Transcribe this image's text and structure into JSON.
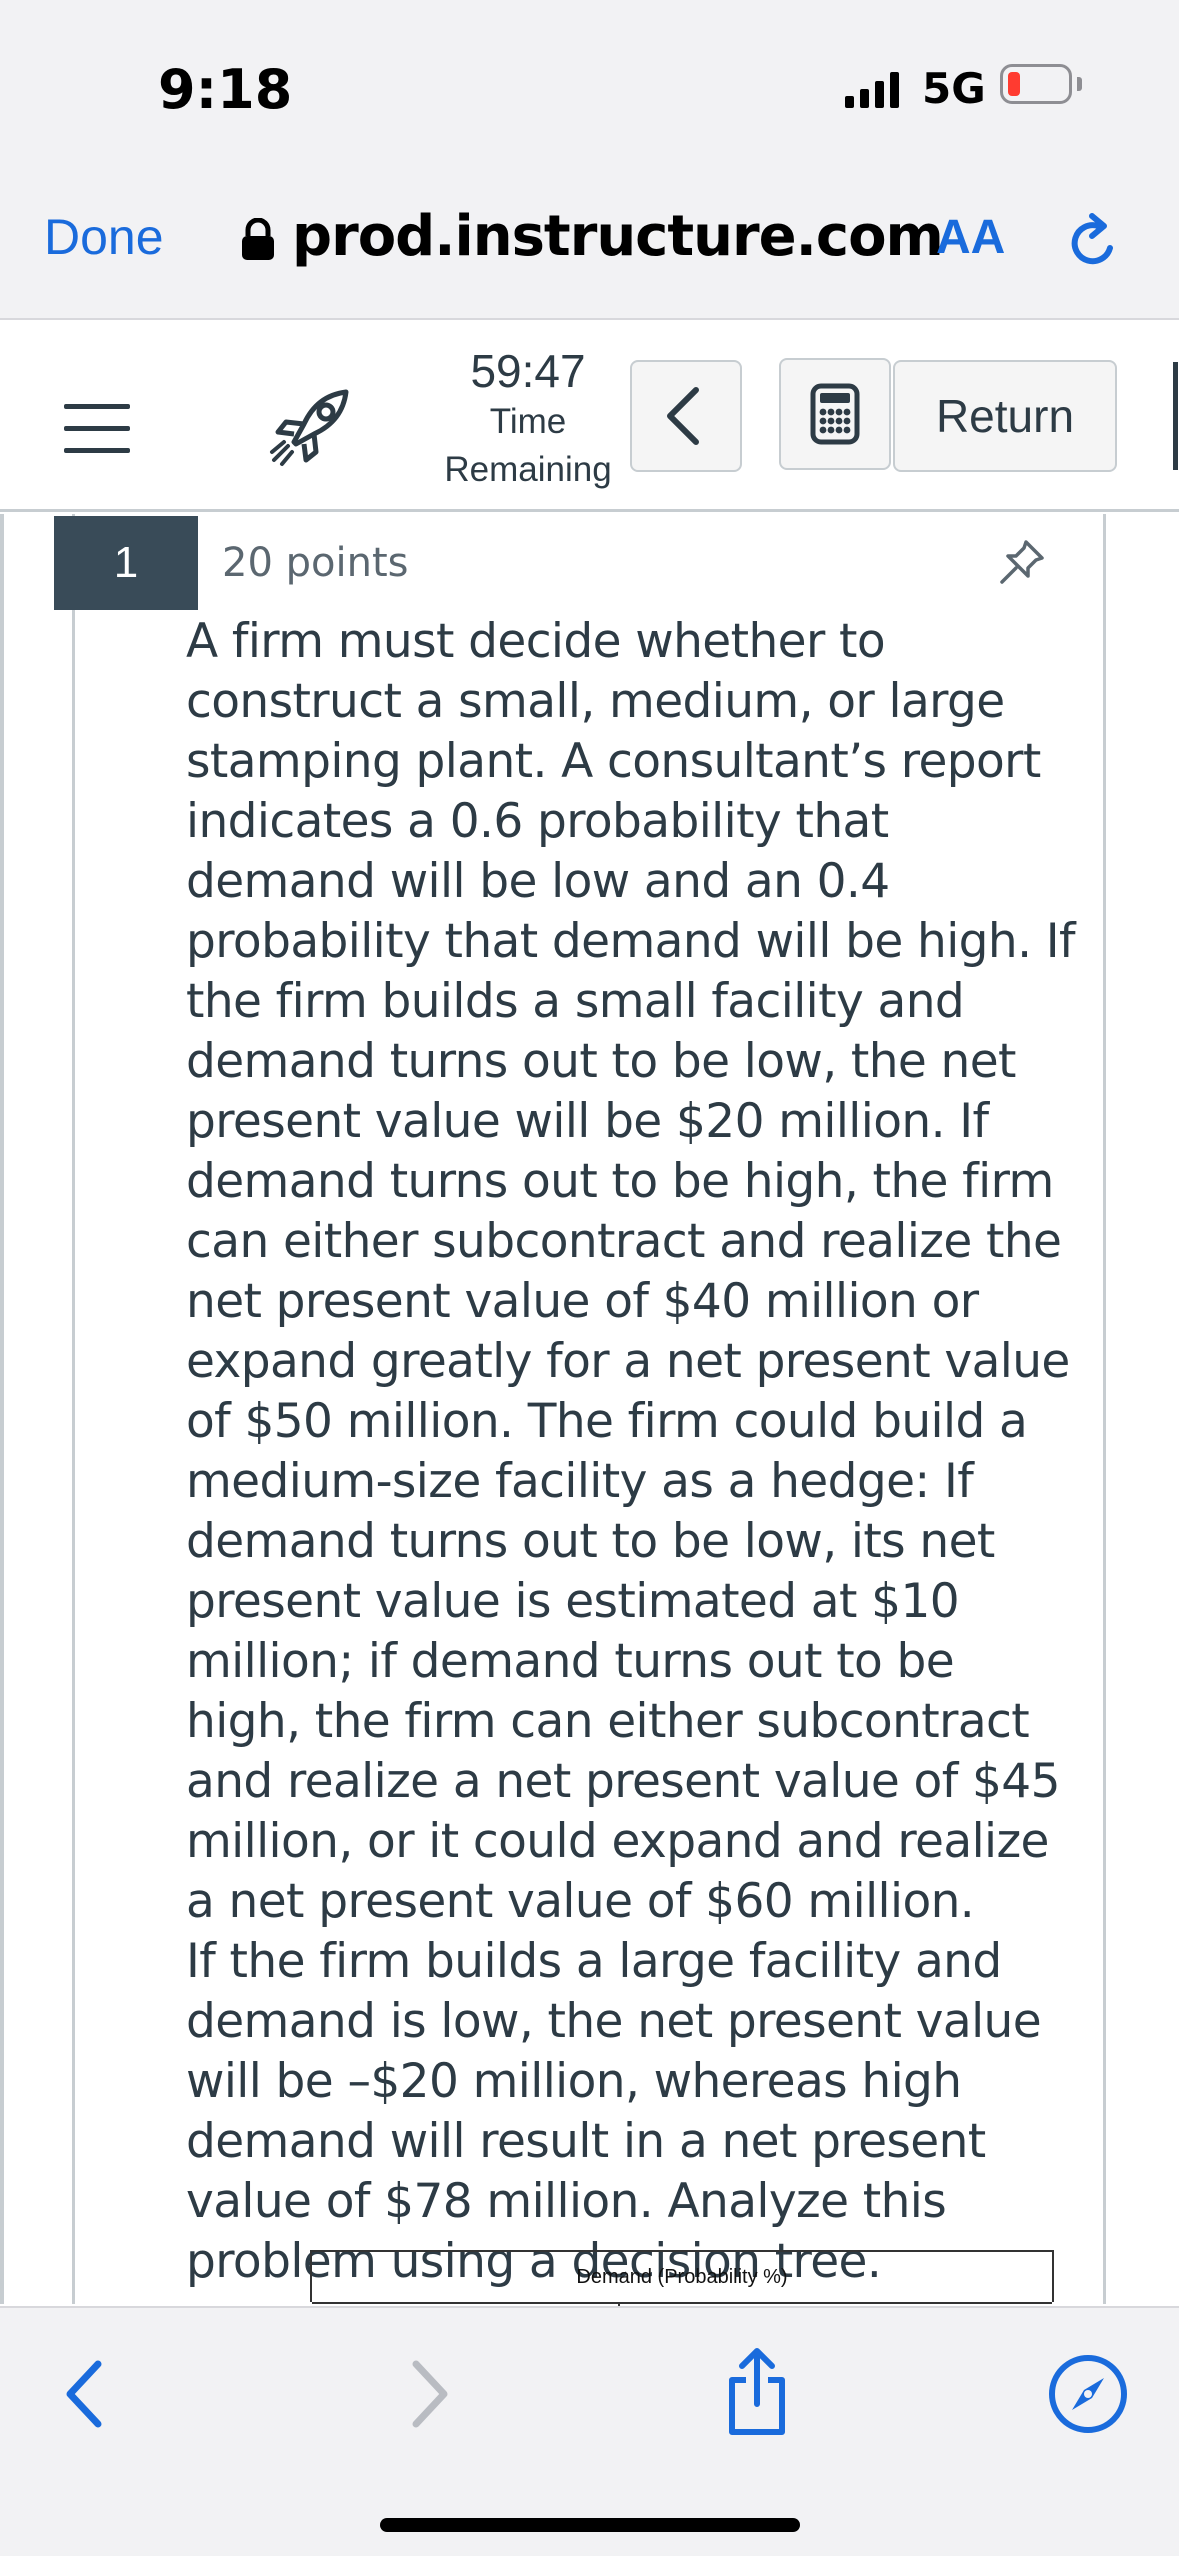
{
  "status_bar": {
    "time": "9:18",
    "network": "5G",
    "battery_color": "#ff3b30"
  },
  "browser": {
    "done_label": "Done",
    "url": "prod.instructure.com",
    "aa_label": "AA",
    "lock_icon": "lock-icon",
    "reload_icon": "reload-icon",
    "accent_color": "#1a6bdc"
  },
  "quiz_bar": {
    "menu_icon": "hamburger-icon",
    "rocket_icon": "rocket-icon",
    "timer_value": "59:47",
    "timer_label_1": "Time",
    "timer_label_2": "Remaining",
    "back_icon": "chevron-left-icon",
    "calculator_icon": "calculator-icon",
    "return_label": "Return"
  },
  "question": {
    "number": "1",
    "points": "20 points",
    "pin_icon": "pin-icon",
    "paragraph_1": "A firm must decide whether to construct a small, medium, or large stamping plant. A consultant’s report indicates a 0.6 probability that demand will be low and an 0.4 probability that demand will be high. If the firm builds a small facility and demand turns out to be low, the net present value will be $20 million. If demand turns out to be high, the firm can either subcontract and realize the net present value of $40 million or expand greatly for a net present value of $50 million. The firm could build a medium-size facility as a hedge: If demand turns out to be low, its net present value is estimated at $10 million; if demand turns out to be high, the firm can either subcontract and realize a net present value of $45 million, or it could expand and realize a net present value of $60 million.",
    "paragraph_2": "If the firm builds a large facility and demand is low, the net present value will be –$20 million, whereas high demand will result in a net present value of $78 million. Analyze this problem using a decision tree.",
    "table_header": "Demand (Probability %)"
  },
  "bottom_toolbar": {
    "back_icon": "chevron-left-icon",
    "forward_icon": "chevron-right-icon",
    "share_icon": "share-icon",
    "compass_icon": "compass-icon"
  }
}
